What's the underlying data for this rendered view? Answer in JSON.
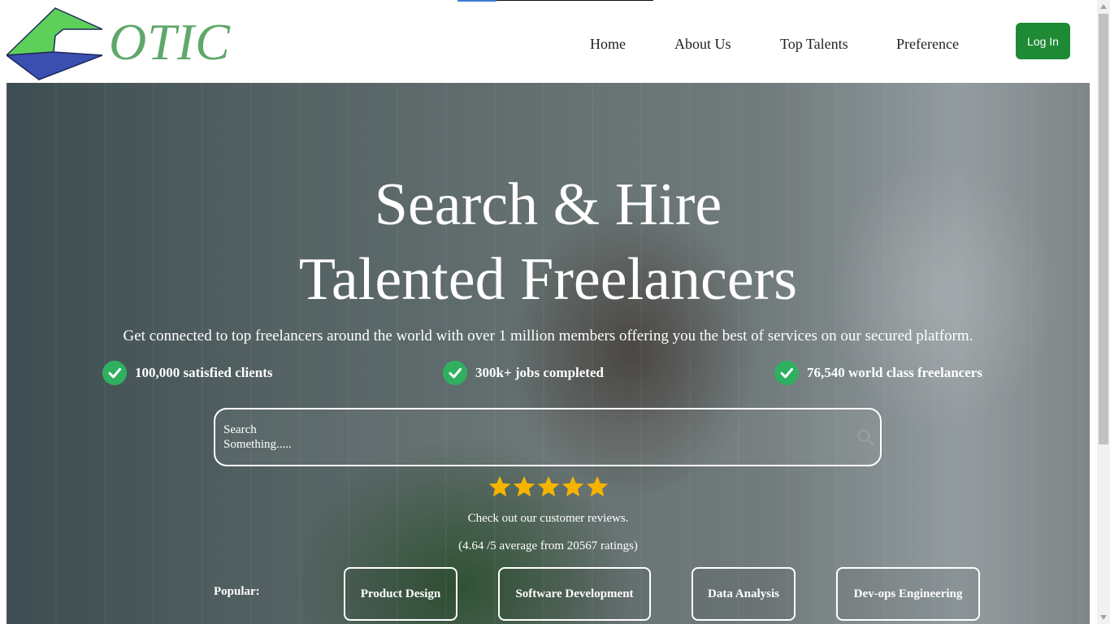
{
  "brand": {
    "logo_text": "OTIC",
    "colors": {
      "green": "#5fa86a",
      "blue": "#3b4fb0",
      "button": "#1f8a35"
    }
  },
  "nav": {
    "items": [
      {
        "label": "Home"
      },
      {
        "label": "About Us"
      },
      {
        "label": "Top Talents"
      },
      {
        "label": "Preference"
      }
    ],
    "login_label": "Log In"
  },
  "hero": {
    "title_line1": "Search & Hire",
    "title_line2": "Talented Freelancers",
    "subtitle": "Get connected to top freelancers around the world with over 1 million members offering you the best of services on our secured platform.",
    "stats": [
      {
        "text": "100,000 satisfied clients",
        "icon": "check-circle-icon"
      },
      {
        "text": "300k+ jobs completed",
        "icon": "check-circle-icon"
      },
      {
        "text": "76,540 world class freelancers",
        "icon": "check-circle-icon"
      }
    ],
    "search": {
      "placeholder": "Search Something.....",
      "icon": "search-icon"
    },
    "rating": {
      "stars": 5,
      "reviews_link": "Check out our customer reviews.",
      "summary": "(4.64 /5 average from 20567 ratings)"
    },
    "popular": {
      "label": "Popular:",
      "tags": [
        "Product Design",
        "Software Development",
        "Data Analysis",
        "Dev-ops Engineering"
      ]
    }
  }
}
